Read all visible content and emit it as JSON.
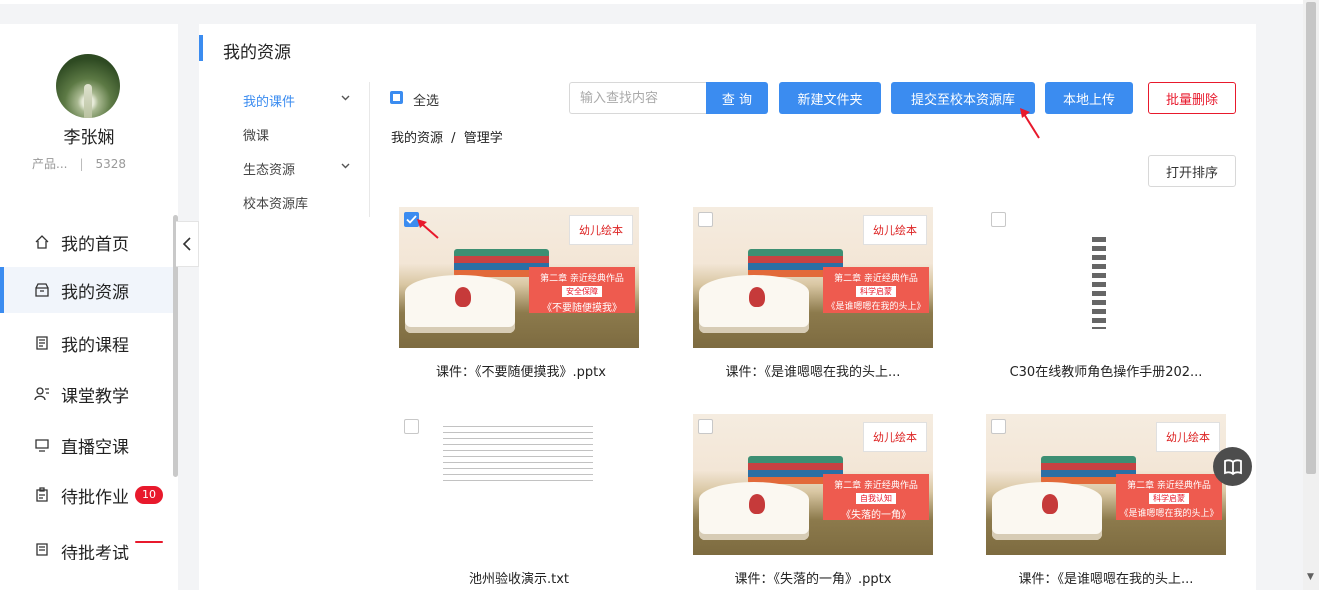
{
  "user": {
    "name": "李张娴",
    "org": "产品...",
    "id_number": "5328"
  },
  "nav": [
    {
      "label": "我的首页",
      "icon": "home-icon",
      "active": false
    },
    {
      "label": "我的资源",
      "icon": "resource-box-icon",
      "active": true
    },
    {
      "label": "我的课程",
      "icon": "course-doc-icon",
      "active": false
    },
    {
      "label": "课堂教学",
      "icon": "teacher-icon",
      "active": false
    },
    {
      "label": "直播空课",
      "icon": "monitor-icon",
      "active": false
    },
    {
      "label": "待批作业",
      "icon": "homework-icon",
      "active": false,
      "badge": "10"
    },
    {
      "label": "待批考试",
      "icon": "exam-icon",
      "active": false,
      "badge": ""
    }
  ],
  "page_title": "我的资源",
  "subnav": [
    {
      "label": "我的课件",
      "active": true,
      "has_chevron": true
    },
    {
      "label": "微课",
      "active": false,
      "has_chevron": false
    },
    {
      "label": "生态资源",
      "active": false,
      "has_chevron": true
    },
    {
      "label": "校本资源库",
      "active": false,
      "has_chevron": false
    }
  ],
  "toolbar": {
    "select_all": "全选",
    "search_placeholder": "输入查找内容",
    "search_button": "查 询",
    "new_folder": "新建文件夹",
    "submit_school": "提交至校本资源库",
    "local_upload": "本地上传",
    "batch_delete": "批量删除",
    "open_sort": "打开排序"
  },
  "breadcrumb": {
    "root": "我的资源",
    "separator": "/",
    "current": "管理学"
  },
  "cards": [
    {
      "caption": "课件：《不要随便摸我》.pptx",
      "kind": "ppt",
      "checked": true,
      "chapter": "第二章  亲近经典作品",
      "tag": "安全保障",
      "book_title": "《不要随便摸我》"
    },
    {
      "caption": "课件：《是谁嗯嗯在我的头上...",
      "kind": "ppt",
      "checked": false,
      "chapter": "第二章  亲近经典作品",
      "tag": "科学启蒙",
      "book_title": "《是谁嗯嗯在我的头上》"
    },
    {
      "caption": "C30在线教师角色操作手册202...",
      "kind": "vertical-doc",
      "checked": false
    },
    {
      "caption": "池州验收演示.txt",
      "kind": "text-doc",
      "checked": false
    },
    {
      "caption": "课件：《失落的一角》.pptx",
      "kind": "ppt",
      "checked": false,
      "chapter": "第二章  亲近经典作品",
      "tag": "自我认知",
      "book_title": "《失落的一角》"
    },
    {
      "caption": "课件：《是谁嗯嗯在我的头上...",
      "kind": "ppt",
      "checked": false,
      "chapter": "第二章  亲近经典作品",
      "tag": "科学启蒙",
      "book_title": "《是谁嗯嗯在我的头上》"
    }
  ],
  "thumb_logo": "幼儿绘本",
  "colors": {
    "primary": "#3b8cf0",
    "danger": "#e8192c",
    "annotation_arrow": "#e8192c"
  }
}
